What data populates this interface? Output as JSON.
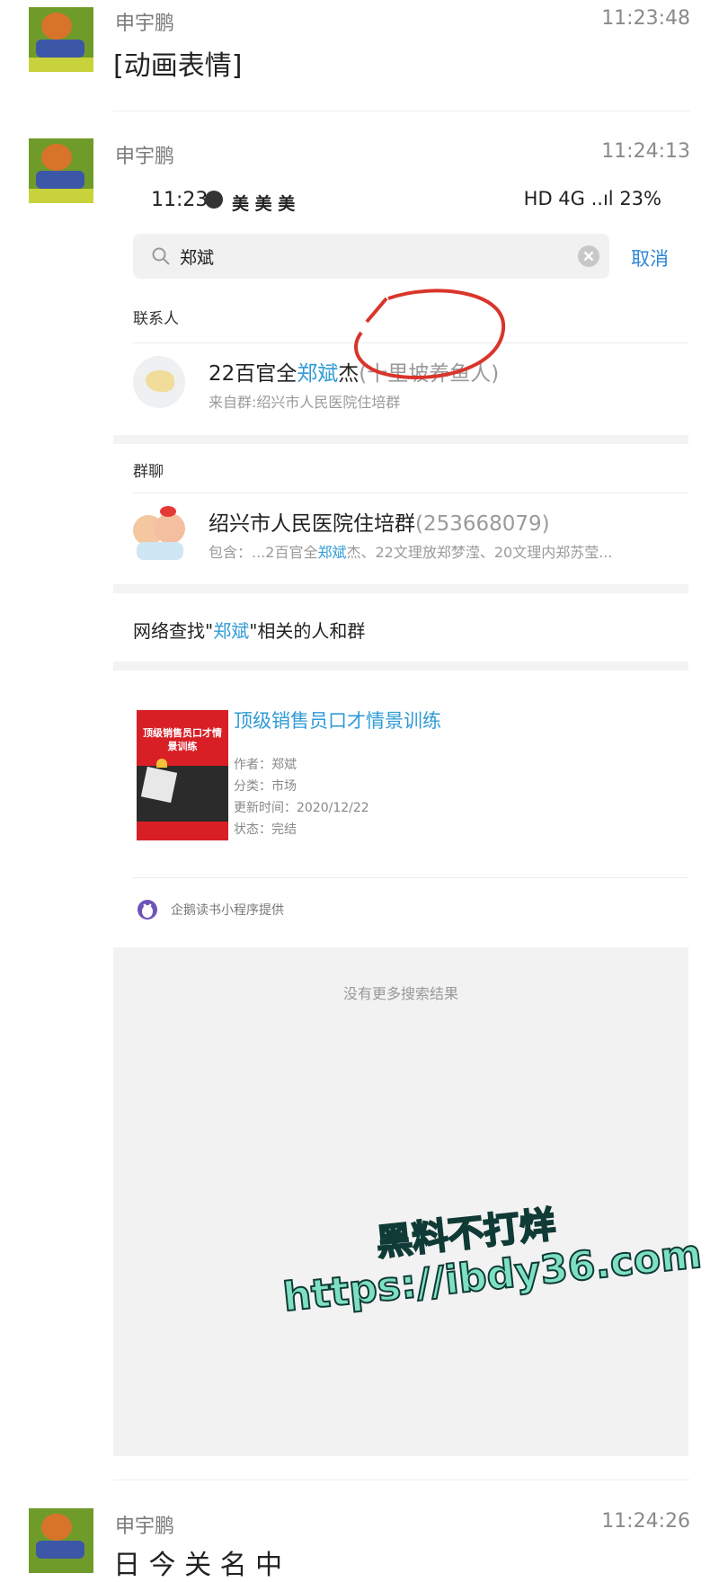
{
  "messages": [
    {
      "sender": "申宇鹏",
      "time": "11:23:48",
      "text": "[动画表情]"
    },
    {
      "sender": "申宇鹏",
      "time": "11:24:13"
    },
    {
      "sender": "申宇鹏",
      "time": "11:24:26",
      "text": "日 今 关 名 中"
    }
  ],
  "screenshot": {
    "status": {
      "clock": "11:23",
      "carrier": "美 美 美",
      "right": "HD 4G ..ıl 23%"
    },
    "search": {
      "query": "郑斌",
      "cancel": "取消"
    },
    "contacts_label": "联系人",
    "contact": {
      "title_pre": "22百官全",
      "title_hl": "郑斌",
      "title_post": "杰",
      "title_paren": "(十里坡养鱼人)",
      "sub": "来自群:绍兴市人民医院住培群"
    },
    "groups_label": "群聊",
    "group": {
      "title": "绍兴市人民医院住培群",
      "id": "(253668079)",
      "sub_pre": "包含：...2百官全",
      "sub_hl": "郑斌",
      "sub_post": "杰、22文理放郑梦滢、20文理内郑苏莹..."
    },
    "web_search": {
      "pre": "网络查找\"",
      "hl": "郑斌",
      "post": "\"相关的人和群"
    },
    "book": {
      "cover_title": "顶级销售员口才情景训练",
      "title": "顶级销售员口才情景训练",
      "author": "作者：郑斌",
      "category": "分类：市场",
      "updated": "更新时间：2020/12/22",
      "status": "状态：完结"
    },
    "provider": "企鹅读书小程序提供",
    "no_more": "没有更多搜索结果"
  },
  "watermark": {
    "line1": "黑料不打烊",
    "line2": "https://ibdy36.com"
  },
  "colors": {
    "highlight": "#2f9bd6",
    "annotation": "#d9352b",
    "watermark": "#7ee0c3",
    "book_cover": "#d81f26"
  }
}
